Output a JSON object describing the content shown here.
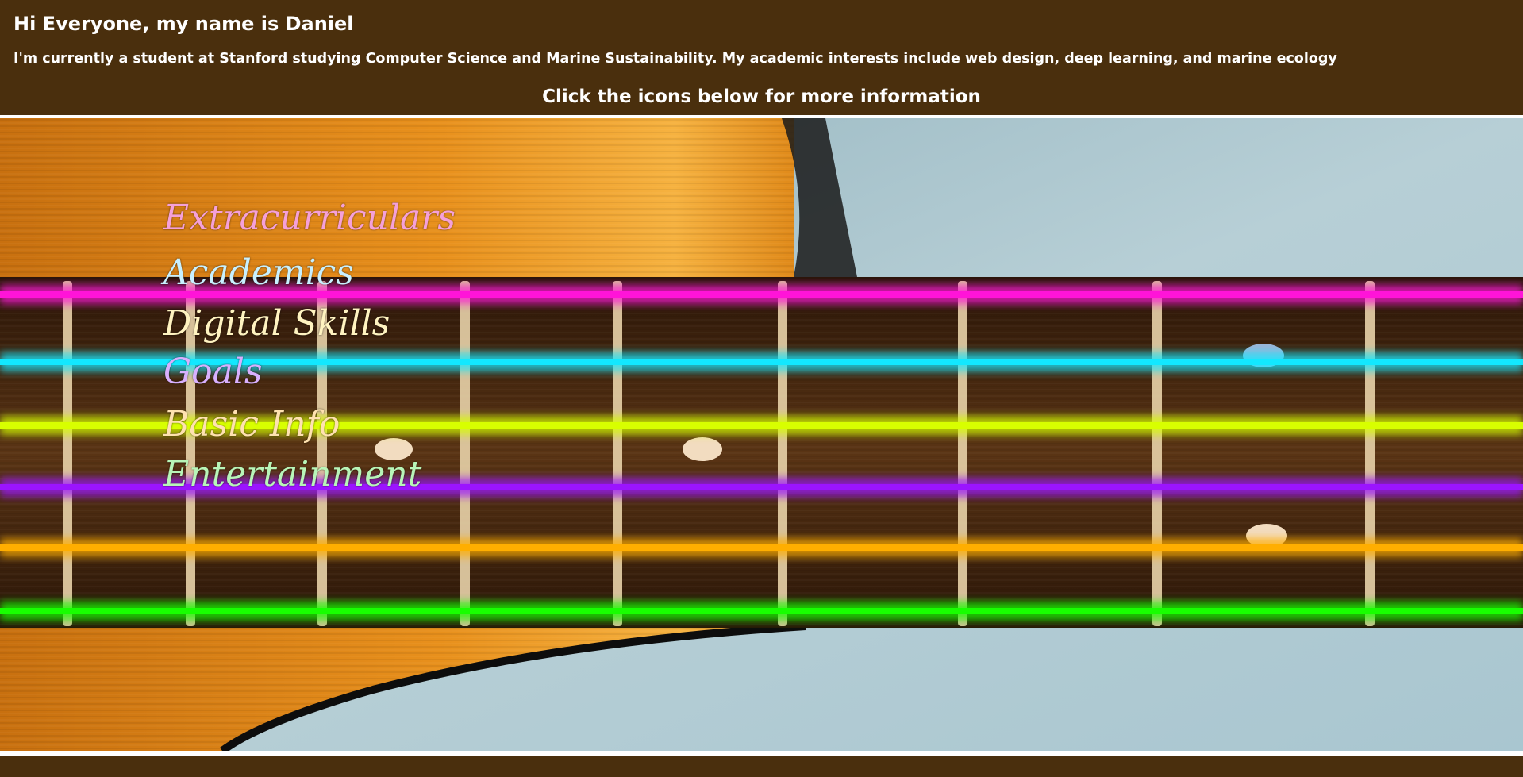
{
  "header": {
    "greeting": "Hi Everyone, my name is Daniel",
    "intro": "I'm currently a student at Stanford studying Computer Science and Marine Sustainability. My academic interests include web design, deep learning, and marine ecology",
    "cta": "Click the icons below for more information"
  },
  "nav": {
    "links": [
      {
        "label": "Extracurriculars",
        "color": "#f5a0d8"
      },
      {
        "label": "Academics",
        "color": "#c8f0ff"
      },
      {
        "label": "Digital Skills",
        "color": "#fff3c0"
      },
      {
        "label": "Goals",
        "color": "#d8b0ff"
      },
      {
        "label": "Basic Info",
        "color": "#ffe2b0"
      },
      {
        "label": "Entertainment",
        "color": "#b8f5b8"
      }
    ]
  },
  "strings": {
    "colors": [
      "#ff14d8",
      "#12e8ff",
      "#d8ff00",
      "#9b14ff",
      "#ffae00",
      "#18ff00"
    ]
  },
  "colors": {
    "page_bg": "#4a2f0d",
    "guitar_wood": "#e08a1a",
    "fretboard": "#3a1f0c",
    "body_blue": "#a9c8d4"
  }
}
